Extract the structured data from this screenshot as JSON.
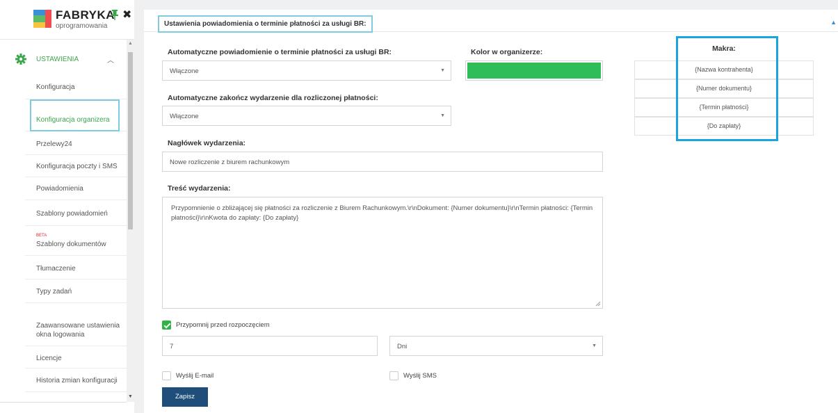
{
  "app": {
    "logo_title": "FABRYKA",
    "logo_subtitle": "oprogramowania"
  },
  "sidebar": {
    "section_label": "USTAWIENIA",
    "items": [
      {
        "label": "Konfiguracja"
      },
      {
        "label": "Konfiguracja organizera",
        "active": true
      },
      {
        "label": "Przelewy24"
      },
      {
        "label": "Konfiguracja poczty i SMS"
      },
      {
        "label": "Powiadomienia"
      },
      {
        "label": "Szablony powiadomień"
      },
      {
        "label": "Szablony dokumentów",
        "badge": "BETA"
      },
      {
        "label": "Tłumaczenie"
      },
      {
        "label": "Typy zadań"
      },
      {
        "label": "Zaawansowane ustawienia",
        "label2": "okna logowania"
      },
      {
        "label": "Licencje"
      },
      {
        "label": "Historia zmian konfiguracji"
      }
    ]
  },
  "header": {
    "title": "Ustawienia powiadomienia o terminie płatności za usługi BR:"
  },
  "form": {
    "auto_notify_label": "Automatyczne powiadomienie o terminie płatności za usługi BR:",
    "auto_notify_value": "Włączone",
    "color_label": "Kolor w organizerze:",
    "color_value": "#2ebd59",
    "auto_close_label": "Automatyczne zakończ wydarzenie dla rozliczonej płatności:",
    "auto_close_value": "Włączone",
    "event_header_label": "Nagłówek wydarzenia:",
    "event_header_value": "Nowe rozliczenie z biurem rachunkowym",
    "event_body_label": "Treść wydarzenia:",
    "event_body_line1": "Przypomnienie o zbliżającej się płatności za rozliczenie z Biurem Rachunkowym.\\r\\nDokument: {Numer dokumentu}\\r\\nTermin płatności: {Termin",
    "event_body_line2": "płatności}\\r\\nKwota do zapłaty: {Do zapłaty}",
    "remind_label": "Przypomnij przed rozpoczęciem",
    "remind_checked": true,
    "remind_amount": "7",
    "remind_unit": "Dni",
    "send_email_label": "Wyślij E-mail",
    "send_sms_label": "Wyślij SMS",
    "save_label": "Zapisz"
  },
  "macros": {
    "title": "Makra:",
    "items": [
      "{Nazwa kontrahenta}",
      "{Numer dokumentu}",
      "{Termin płatności}",
      "{Do zapłaty}"
    ]
  }
}
